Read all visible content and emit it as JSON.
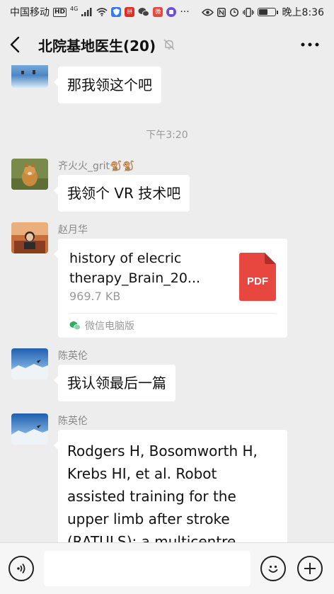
{
  "status_bar": {
    "carrier": "中国移动",
    "hd_badge": "HD",
    "network": "4G",
    "time": "晚上8:36",
    "battery_level": 0.55,
    "app_badge_1": "拼",
    "app_badge_2": "微"
  },
  "header": {
    "title": "北院基地医生(20)",
    "back_icon": "chevron-left-icon",
    "mute_icon": "bell-muted-icon",
    "more_icon": "more-dots-icon"
  },
  "messages": {
    "m0": {
      "text": "那我领这个吧"
    },
    "timestamp": "下午3:20",
    "m1": {
      "sender": "齐火火_grit🐒🐒",
      "text": "我领个 VR 技术吧"
    },
    "m2": {
      "sender": "赵月华",
      "file_name": "history of elecric therapy_Brain_20...",
      "file_size": "969.7 KB",
      "file_type": "PDF",
      "source": "微信电脑版"
    },
    "m3": {
      "sender": "陈英伦",
      "text": "我认领最后一篇"
    },
    "m4": {
      "sender": "陈英伦",
      "text": "Rodgers H, Bosomworth H, Krebs HI, et al. Robot assisted training for the upper limb after stroke (RATULS): a multicentre randomised"
    }
  },
  "input_bar": {
    "voice_icon": "voice-icon",
    "input_value": "",
    "emoji_icon": "emoji-icon",
    "plus_icon": "plus-icon"
  },
  "colors": {
    "background": "#ededed",
    "bubble": "#ffffff",
    "pdf_red": "#e8473f",
    "wechat_green": "#2aae67"
  }
}
